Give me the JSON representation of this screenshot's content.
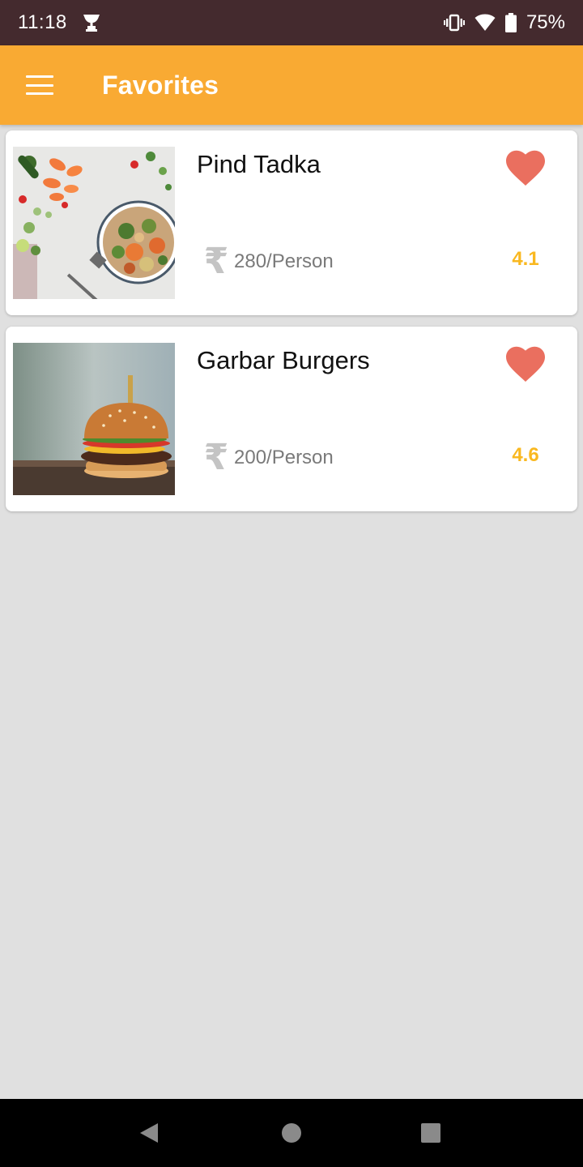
{
  "status_bar": {
    "time": "11:18",
    "battery_percent": "75%",
    "icons": [
      "trophy-icon",
      "vibrate-icon",
      "wifi-icon",
      "battery-icon"
    ]
  },
  "app_bar": {
    "title": "Favorites",
    "menu_icon": "hamburger-menu-icon",
    "background_color": "#f9aa33"
  },
  "favorites": [
    {
      "name": "Pind Tadka",
      "price": "280/Person",
      "currency_icon": "rupee-icon",
      "rating": "4.1",
      "favorited": true,
      "image": "salad-bowl-photo"
    },
    {
      "name": "Garbar Burgers",
      "price": "200/Person",
      "currency_icon": "rupee-icon",
      "rating": "4.6",
      "favorited": true,
      "image": "burger-photo"
    }
  ],
  "colors": {
    "heart": "#ea6f5f",
    "rating": "#f9b820",
    "status_bar": "#442a2e"
  },
  "nav_bar": {
    "buttons": [
      "back-icon",
      "home-icon",
      "recents-icon"
    ]
  }
}
